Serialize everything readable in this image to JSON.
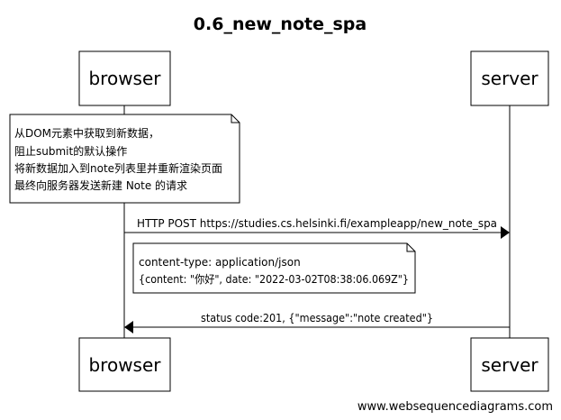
{
  "title": "0.6_new_note_spa",
  "participants": {
    "browser": "browser",
    "server": "server"
  },
  "note_browser": {
    "lines": [
      "从DOM元素中获取到新数据，",
      "阻止submit的默认操作",
      "将新数据加入到note列表里并重新渲染页面",
      "最终向服务器发送新建 Note 的请求"
    ]
  },
  "messages": [
    {
      "text": "HTTP POST https://studies.cs.helsinki.fi/exampleapp/new_note_spa",
      "from": "browser",
      "to": "server"
    },
    {
      "text": "status code:201, {\"message\":\"note created\"}",
      "from": "server",
      "to": "browser"
    }
  ],
  "note_request": {
    "lines": [
      "content-type: application/json",
      "{content: \"你好\", date: \"2022-03-02T08:38:06.069Z\"}"
    ]
  },
  "footer": "www.websequencediagrams.com"
}
